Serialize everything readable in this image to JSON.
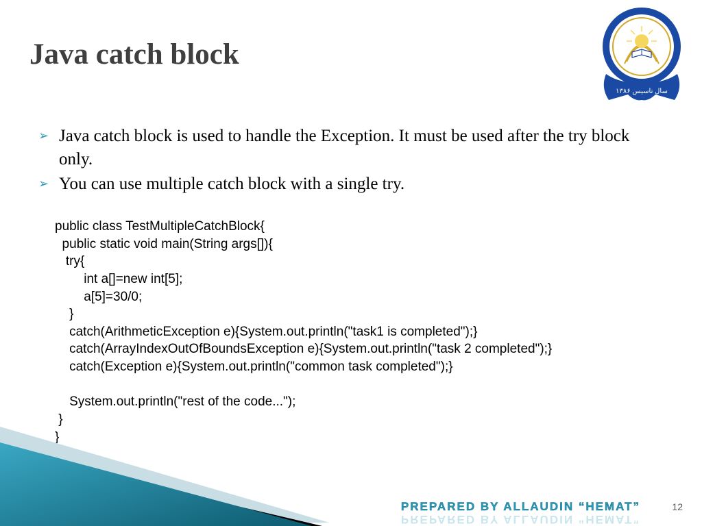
{
  "title": "Java catch block",
  "bullets": [
    "Java catch block is used to handle the Exception. It must be used after the try block only.",
    "You can use multiple catch block with a single try."
  ],
  "code": "public class TestMultipleCatchBlock{\n  public static void main(String args[]){\n   try{\n        int a[]=new int[5];\n        a[5]=30/0;\n    }\n    catch(ArithmeticException e){System.out.println(\"task1 is completed\");}\n    catch(ArrayIndexOutOfBoundsException e){System.out.println(\"task 2 completed\");}\n    catch(Exception e){System.out.println(\"common task completed\");}\n\n    System.out.println(\"rest of the code...\");\n }\n}",
  "footer": "PREPARED  BY  ALLAUDIN  “HEMAT”",
  "page_number": "12",
  "logo": {
    "year_text": "سال تاسیس ۱۳۸۶"
  }
}
